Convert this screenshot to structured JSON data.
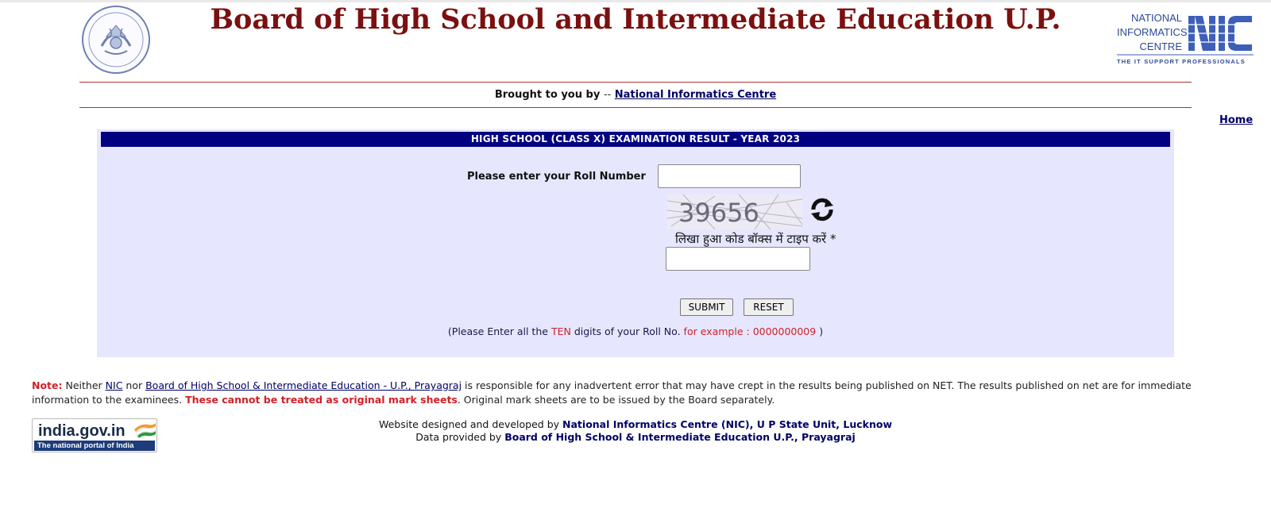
{
  "header": {
    "title": "Board of High School and Intermediate Education U.P.",
    "nic_logo": {
      "line1": "NATIONAL",
      "line2": "INFORMATICS",
      "line3": "CENTRE",
      "tagline": "THE IT SUPPORT PROFESSIONALS"
    },
    "brought_prefix": "Brought to you by",
    "brought_sep": "--",
    "brought_link": "National Informatics Centre",
    "home_link": "Home"
  },
  "panel": {
    "heading": "HIGH SCHOOL (CLASS X)  EXAMINATION RESULT - YEAR 2023",
    "roll_label": "Please enter your Roll Number",
    "roll_value": "",
    "captcha_code": "39656",
    "captcha_hint": "लिखा हुआ कोड बॉक्स में टाइप करें",
    "captcha_required": "*",
    "captcha_value": "",
    "submit_label": "SUBMIT",
    "reset_label": "RESET",
    "instruction": {
      "part1": "(Please Enter all the",
      "ten": "TEN",
      "part2": "digits of your Roll No.",
      "example_prefix": "for example :",
      "example_value": "0000000009",
      "close": ")"
    }
  },
  "note": {
    "label": "Note",
    "colon": ":",
    "text1": "Neither",
    "nic_link": "NIC",
    "text2": "nor",
    "board_link": "Board of High School & Intermediate Education - U.P., Prayagraj",
    "text3": "is responsible for any inadvertent error that may have crept in the results being published on NET. The results published on net are for immediate information to the examinees.",
    "bold_warning": "These cannot be treated as original mark sheets",
    "text4": ". Original mark sheets are to be issued by the Board separately."
  },
  "india_portal": {
    "name": "india.gov.in",
    "tagline": "The national portal of India"
  },
  "footer": {
    "line1_prefix": "Website designed and developed by",
    "line1_bold": "National Informatics Centre (NIC), U P State Unit, Lucknow",
    "line2_prefix": "Data provided by",
    "line2_bold": "Board of High School & Intermediate Education U.P., Prayagraj"
  },
  "colors": {
    "title": "#7b1010",
    "panel_bg": "#e6e6ff",
    "panel_head": "#000080",
    "accent_red": "#d0202a",
    "link": "#000066",
    "nic_blue": "#2c4a9a"
  },
  "icons": {
    "emblem": "up-emblem-icon",
    "refresh": "refresh-icon",
    "flag": "india-flag-icon"
  }
}
